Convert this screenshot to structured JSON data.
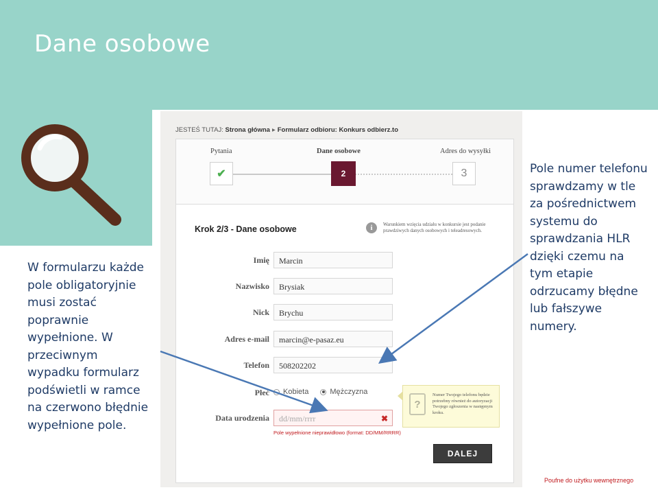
{
  "slide": {
    "title": "Dane osobowe",
    "left_text": "W formularzu każde pole obligatoryjnie musi zostać poprawnie wypełnione. W przeciwnym wypadku formularz podświetli w ramce na czerwono błędnie wypełnione pole.",
    "right_text": "Pole numer telefonu sprawdzamy w tle za pośrednictwem systemu do sprawdzania HLR dzięki czemu na tym etapie odrzucamy błędne lub fałszywe numery.",
    "footer": "Poufne do użytku wewnętrznego",
    "colors": {
      "band": "#98d4c9",
      "text": "#1f3b66",
      "arrow": "#4a78b4",
      "footer": "#c0181c"
    },
    "icons": [
      "magnifier-icon"
    ]
  },
  "screenshot": {
    "breadcrumb": {
      "prefix": "JESTEŚ TUTAJ:",
      "home": "Strona główna",
      "current": "Formularz odbioru: Konkurs odbierz.to"
    },
    "steps": [
      {
        "label": "Pytania",
        "marker": "✔",
        "state": "done"
      },
      {
        "label": "Dane osobowe",
        "marker": "2",
        "state": "active"
      },
      {
        "label": "Adres do wysyłki",
        "marker": "3",
        "state": "pending"
      }
    ],
    "form_title": "Krok 2/3 - Dane osobowe",
    "info_text": "Warunkiem wzięcia udziału w konkursie jest podanie prawdziwych danych osobowych i teleadresowych.",
    "fields": {
      "first_name": {
        "label": "Imię",
        "value": "Marcin"
      },
      "last_name": {
        "label": "Nazwisko",
        "value": "Brysiak"
      },
      "nick": {
        "label": "Nick",
        "value": "Brychu"
      },
      "email": {
        "label": "Adres e-mail",
        "value": "marcin@e-pasaz.eu"
      },
      "phone": {
        "label": "Telefon",
        "value": "508202202"
      },
      "gender": {
        "label": "Płeć",
        "options": [
          "Kobieta",
          "Mężczyzna"
        ],
        "selected": "Mężczyzna"
      },
      "birthdate": {
        "label": "Data urodzenia",
        "placeholder": "dd/mm/rrrr",
        "error": "Pole wypełnione nieprawidłowo (format: DD/MM/RRRR)"
      }
    },
    "phone_tooltip": "Numer Twojego telefonu będzie potrzebny również do autoryzacji Twojego zgłoszenia w następnym kroku.",
    "next_button": "DALEJ"
  }
}
